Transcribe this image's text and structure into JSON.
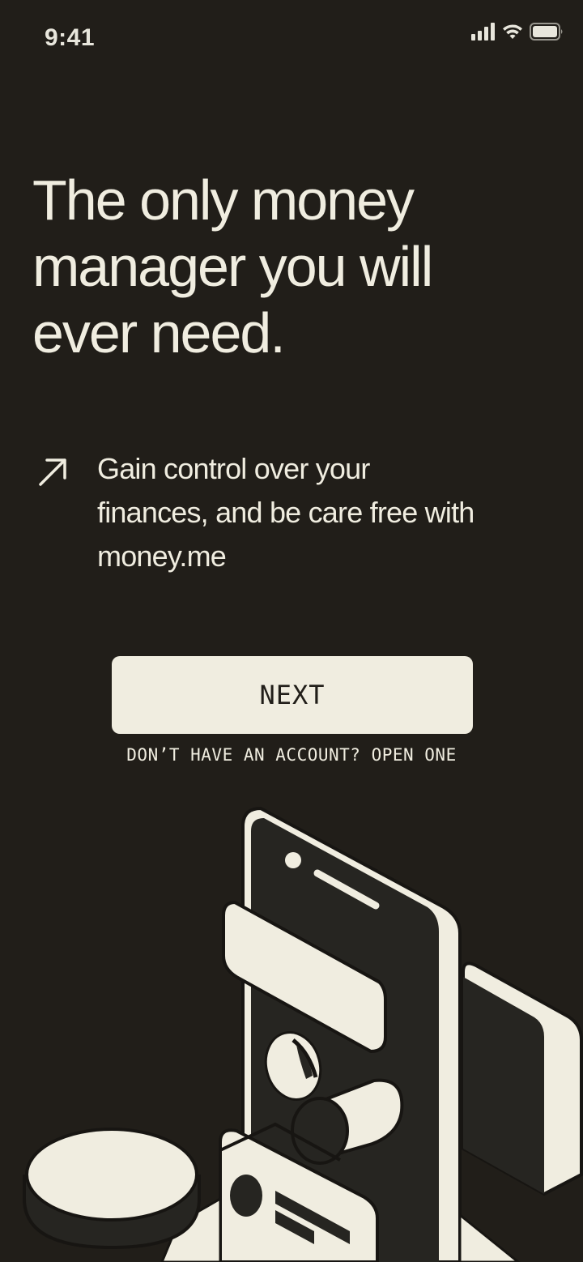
{
  "status_bar": {
    "time": "9:41",
    "icons": [
      "signal-icon",
      "wifi-icon",
      "battery-icon"
    ]
  },
  "hero": {
    "headline": "The only money manager you will ever need.",
    "tagline": "Gain control over your finances, and be care free with money.me",
    "tagline_icon": "arrow-up-right-icon"
  },
  "actions": {
    "next_label": "NEXT",
    "account_link": "DON’T HAVE AN ACCOUNT? OPEN ONE"
  },
  "colors": {
    "background": "#211e19",
    "foreground": "#f0ede0",
    "button_bg": "#f0ede0",
    "button_text": "#211e19"
  },
  "illustration": {
    "icon": "isometric-phone-finance-illustration"
  }
}
